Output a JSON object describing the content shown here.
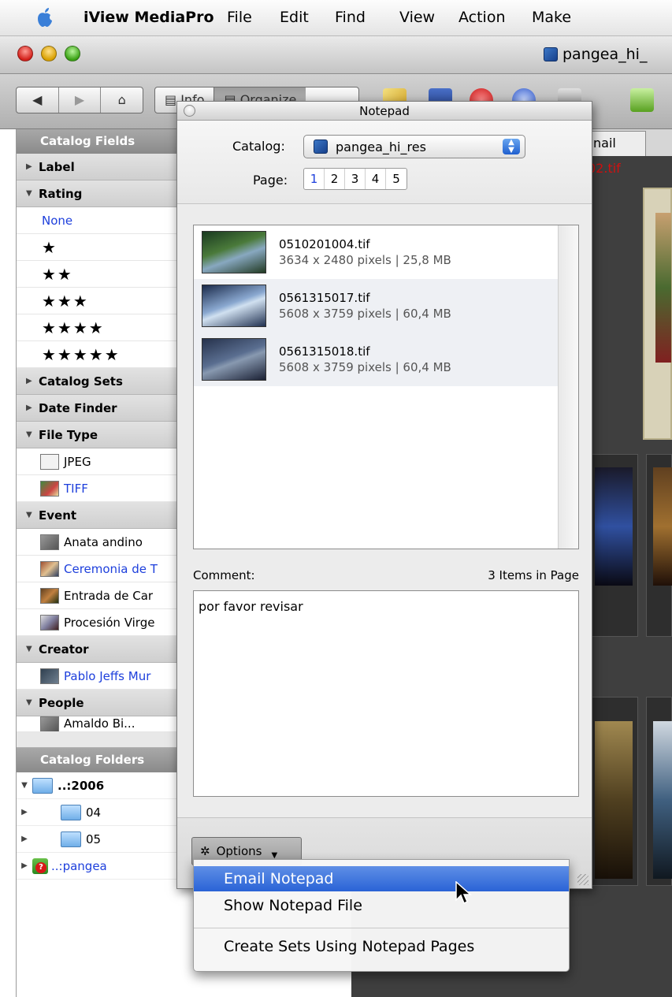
{
  "menubar": {
    "app": "iView MediaPro",
    "items": [
      "File",
      "Edit",
      "Find",
      "View",
      "Action",
      "Make"
    ]
  },
  "window": {
    "title": "pangea_hi_"
  },
  "toolbar": {
    "nav": [
      "◀",
      "▶",
      "⌂"
    ],
    "info_label": "Info",
    "organize_label": "Organize"
  },
  "left": {
    "catalog_fields_header": "Catalog Fields",
    "label": "Label",
    "rating": "Rating",
    "rating_none": "None",
    "stars": [
      "★",
      "★★",
      "★★★",
      "★★★★",
      "★★★★★"
    ],
    "catalog_sets": "Catalog Sets",
    "date_finder": "Date Finder",
    "file_type": "File Type",
    "file_types": [
      "JPEG",
      "TIFF"
    ],
    "event": "Event",
    "events": [
      "Anata andino",
      "Ceremonia de T",
      "Entrada de Car",
      "Procesión Virge"
    ],
    "creator": "Creator",
    "creators": [
      "Pablo Jeffs Mur"
    ],
    "people": "People",
    "people_items": [
      "Amaldo Bi..."
    ],
    "catalog_folders_header": "Catalog Folders",
    "folders": [
      "..:2006",
      "04",
      "05",
      "..:pangea"
    ]
  },
  "right": {
    "tab_label": "nail",
    "selected_filename": "02.tif"
  },
  "notepad": {
    "title": "Notepad",
    "catalog_label": "Catalog:",
    "catalog_value": "pangea_hi_res",
    "page_label": "Page:",
    "pages": [
      "1",
      "2",
      "3",
      "4",
      "5"
    ],
    "items": [
      {
        "name": "0510201004.tif",
        "info": "3634 x 2480 pixels | 25,8 MB"
      },
      {
        "name": "0561315017.tif",
        "info": "5608 x 3759 pixels | 60,4 MB"
      },
      {
        "name": "0561315018.tif",
        "info": "5608 x 3759 pixels | 60,4 MB"
      }
    ],
    "comment_label": "Comment:",
    "count_label": "3 Items in Page",
    "comment_text": "por favor revisar",
    "options_label": "Options"
  },
  "options_menu": {
    "items": [
      "Email Notepad",
      "Show Notepad File",
      "Create Sets Using Notepad Pages"
    ]
  },
  "colors": {
    "highlight": "#2a63d6",
    "link_blue": "#1d3fdc",
    "filename_red": "#d21010"
  }
}
